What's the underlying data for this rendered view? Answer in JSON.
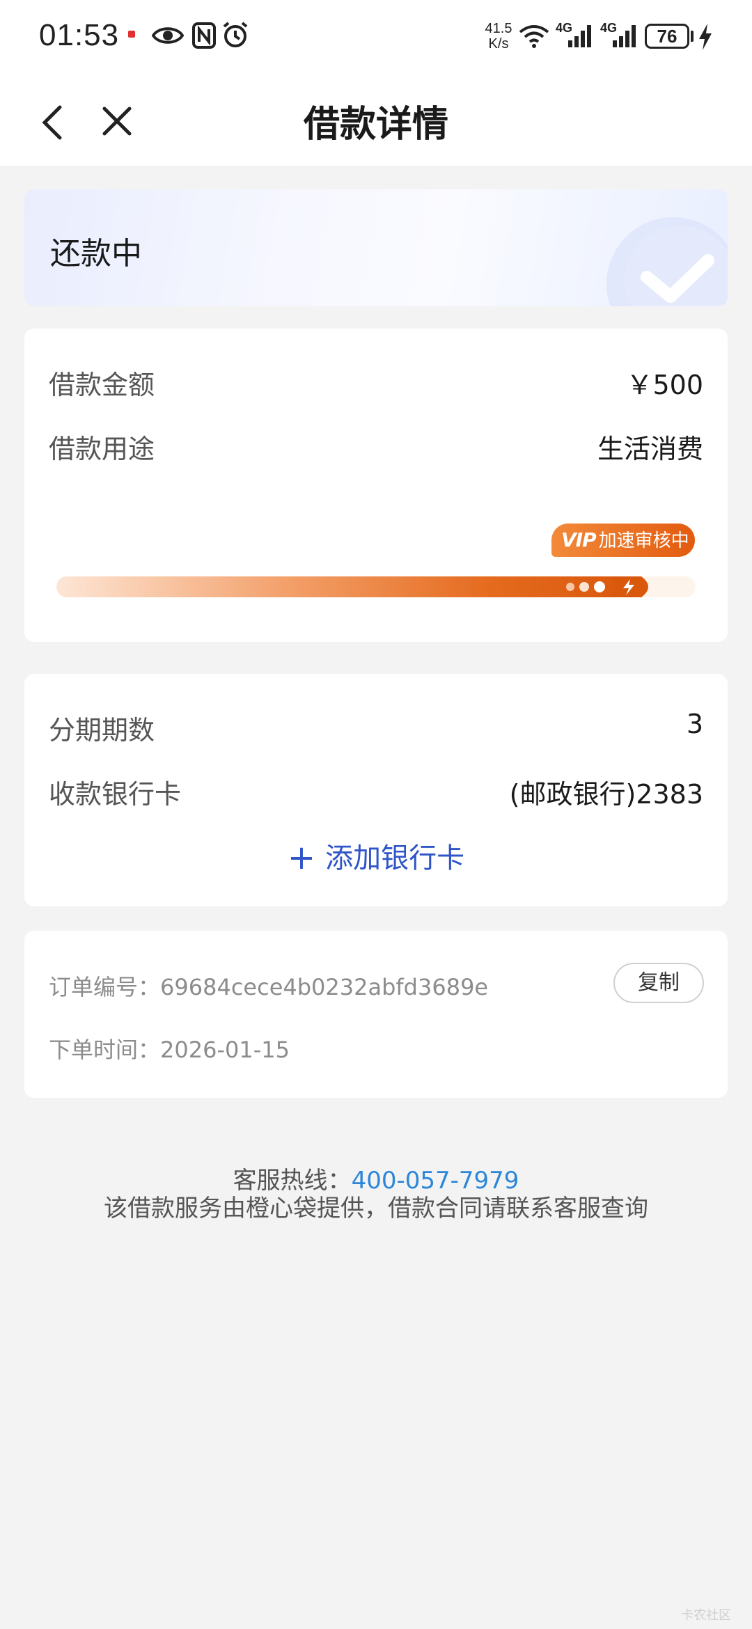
{
  "status_bar": {
    "time": "01:53",
    "net_speed_value": "41.5",
    "net_speed_unit": "K/s",
    "signal_1_label": "4G",
    "signal_2_label": "4G",
    "battery": "76",
    "icons": [
      "notification-icon",
      "eye-icon",
      "nfc-icon",
      "alarm-icon",
      "wifi-icon",
      "cellular-signal-icon",
      "charging-icon"
    ]
  },
  "nav": {
    "title": "借款详情",
    "back_icon": "chevron-left-icon",
    "close_icon": "close-icon"
  },
  "loan_status": {
    "label": "还款中",
    "icon": "check-icon"
  },
  "loan_info": {
    "amount_label": "借款金额",
    "amount_value": "￥500",
    "purpose_label": "借款用途",
    "purpose_value": "生活消费",
    "badge_prefix": "VIP",
    "badge_text": "加速审核中",
    "progress": 0.9,
    "accent_color": "#e35b0f"
  },
  "repayment": {
    "installments_label": "分期期数",
    "installments_value": "3",
    "bank_card_label": "收款银行卡",
    "bank_card_value": "(邮政银行)2383",
    "add_card_label": "添加银行卡",
    "link_color": "#2f55c8"
  },
  "order": {
    "number_label": "订单编号：",
    "number_value": "69684cece4b0232abfd3689e",
    "copy_label": "复制",
    "time_label": "下单时间：",
    "time_value": "2026-01-15"
  },
  "footer": {
    "hotline_label": "客服热线：",
    "hotline_number": "400-057-7979",
    "notice": "该借款服务由橙心袋提供，借款合同请联系客服查询"
  },
  "watermark": "卡农社区"
}
